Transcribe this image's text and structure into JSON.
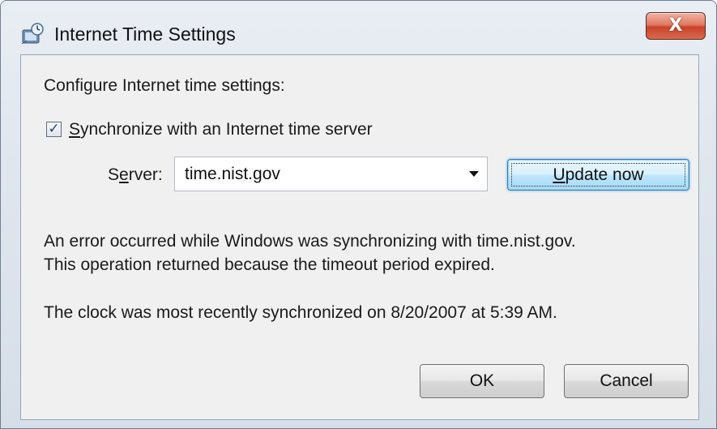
{
  "window": {
    "title": "Internet Time Settings",
    "close_label": "X"
  },
  "content": {
    "heading": "Configure Internet time settings:",
    "sync_checkbox": {
      "checked": true,
      "check_glyph": "✓",
      "label_first": "S",
      "label_rest": "ynchronize with an Internet time server"
    },
    "server": {
      "label_first": "S",
      "label_mid": "e",
      "label_rest": "rver:",
      "value": "time.nist.gov"
    },
    "update_button": {
      "label_first": "U",
      "label_rest": "pdate now"
    },
    "error_line_1": "An error occurred while Windows was synchronizing with time.nist.gov.",
    "error_line_2": "This operation returned because the timeout period expired.",
    "last_sync": "The clock was most recently synchronized on 8/20/2007 at 5:39 AM."
  },
  "buttons": {
    "ok_label": "OK",
    "cancel_label": "Cancel"
  },
  "colors": {
    "close_button": "#c8432a",
    "default_button_glow": "#5fb2e6"
  },
  "icons": {
    "title_icon": "clock-globe-icon",
    "dropdown_icon": "chevron-down-icon"
  }
}
